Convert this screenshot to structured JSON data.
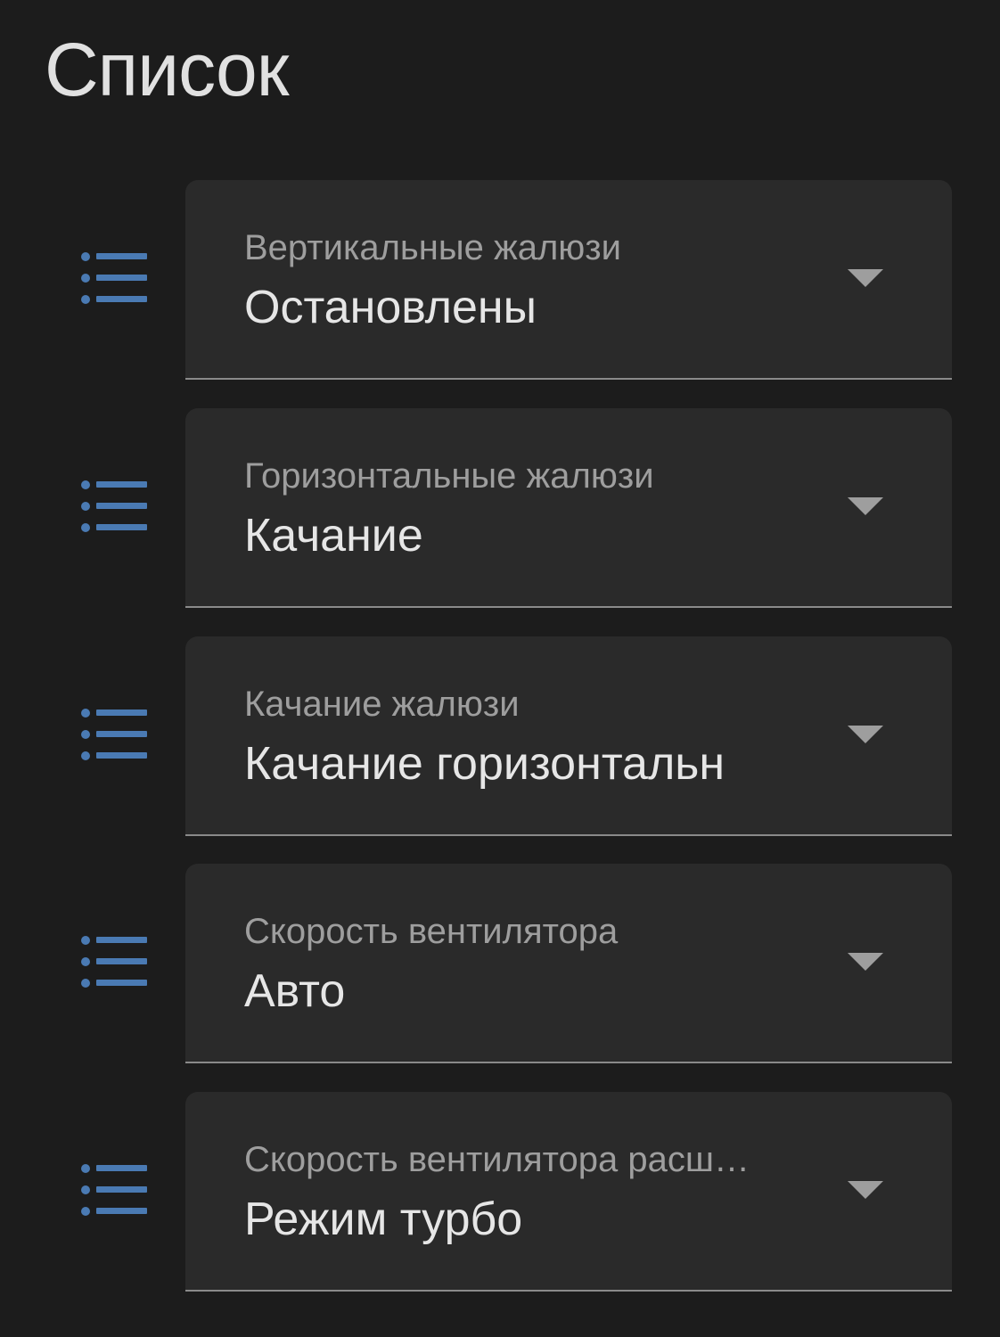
{
  "page": {
    "title": "Список"
  },
  "colors": {
    "background": "#1c1c1c",
    "card": "#2a2a2a",
    "icon": "#4a7ab3",
    "label": "#9e9e9e",
    "value": "#e6e6e6"
  },
  "selects": [
    {
      "icon": "format-list-bulleted-icon",
      "label": "Вертикальные жалюзи",
      "value": "Остановлены"
    },
    {
      "icon": "format-list-bulleted-icon",
      "label": "Горизонтальные жалюзи",
      "value": "Качание"
    },
    {
      "icon": "format-list-bulleted-icon",
      "label": "Качание жалюзи",
      "value": "Качание горизонтальн"
    },
    {
      "icon": "format-list-bulleted-icon",
      "label": "Скорость вентилятора",
      "value": "Авто"
    },
    {
      "icon": "format-list-bulleted-icon",
      "label": "Скорость вентилятора расш…",
      "value": "Режим турбо"
    }
  ]
}
